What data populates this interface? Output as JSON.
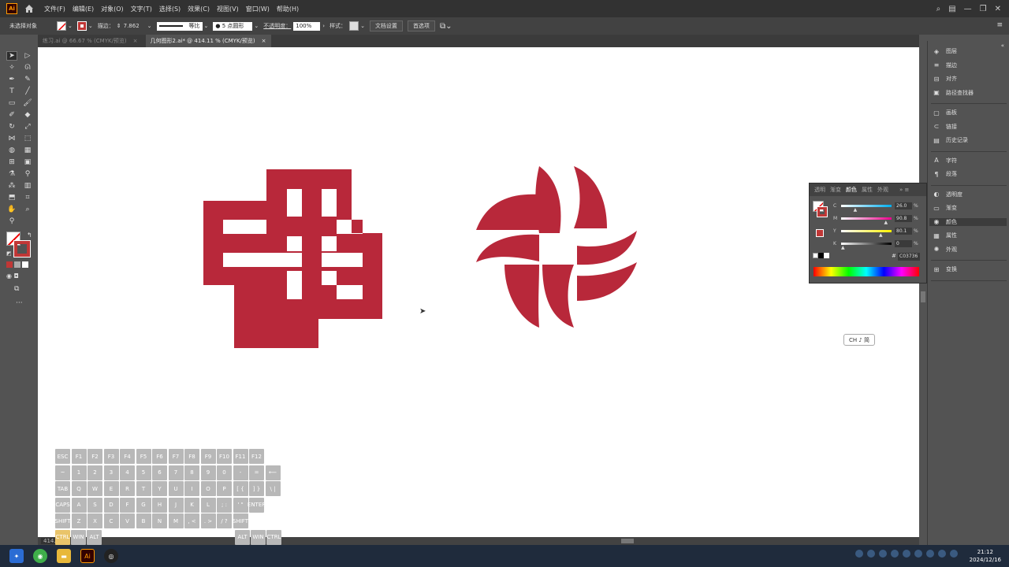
{
  "app": {
    "logo": "Ai"
  },
  "menubar": {
    "items": [
      "文件(F)",
      "编辑(E)",
      "对象(O)",
      "文字(T)",
      "选择(S)",
      "效果(C)",
      "视图(V)",
      "窗口(W)",
      "帮助(H)"
    ]
  },
  "control": {
    "selection": "未选择对象",
    "stroke_label": "描边：",
    "stroke_value": "7.862",
    "line_style": "等比",
    "brush": "5 点圆形",
    "opacity_label": "不透明度：",
    "opacity_value": "100%",
    "style_label": "样式：",
    "doc_setup": "文档设置",
    "prefs": "首选项"
  },
  "tabs": [
    {
      "label": "练习.ai @ 66.67 % (CMYK/预览)",
      "active": false
    },
    {
      "label": "几何图形2.ai* @ 414.11 % (CMYK/预览)",
      "active": true
    }
  ],
  "tab_close": "×",
  "panels": {
    "group1": [
      "图层",
      "描边",
      "对齐",
      "路径查找器"
    ],
    "group2": [
      "画板",
      "链接",
      "历史记录"
    ],
    "group3": [
      "字符",
      "段落"
    ],
    "group4": [
      "透明度",
      "渐变",
      "颜色",
      "属性",
      "外观"
    ],
    "group5": [
      "变换"
    ],
    "active": "颜色"
  },
  "color_panel": {
    "tabs": [
      "透明",
      "渐变",
      "颜色",
      "属性",
      "外观"
    ],
    "active_tab": "颜色",
    "channels": [
      {
        "label": "C",
        "value": "26.0",
        "unit": "%",
        "level": 0.26
      },
      {
        "label": "M",
        "value": "90.8",
        "unit": "%",
        "level": 0.908
      },
      {
        "label": "Y",
        "value": "80.1",
        "unit": "%",
        "level": 0.801
      },
      {
        "label": "K",
        "value": "0",
        "unit": "%",
        "level": 0
      }
    ],
    "hex": "C03736"
  },
  "ime_badge": "CH ♪ 简",
  "zoom": "414.1",
  "keyboard": {
    "row1": [
      "ESC",
      "F1",
      "F2",
      "F3",
      "F4",
      "F5",
      "F6",
      "F7",
      "F8",
      "F9",
      "F10",
      "F11",
      "F12"
    ],
    "row2": [
      "~",
      "1",
      "2",
      "3",
      "4",
      "5",
      "6",
      "7",
      "8",
      "9",
      "0",
      "-",
      "=",
      "⟵"
    ],
    "row3": [
      "TAB",
      "Q",
      "W",
      "E",
      "R",
      "T",
      "Y",
      "U",
      "I",
      "O",
      "P",
      "[ {",
      "] }",
      "\\ |"
    ],
    "row4": [
      "CAPS",
      "A",
      "S",
      "D",
      "F",
      "G",
      "H",
      "J",
      "K",
      "L",
      ";  :",
      "'  \"",
      "ENTER"
    ],
    "row5": [
      "SHIFT",
      "Z",
      "X",
      "C",
      "V",
      "B",
      "N",
      "M",
      ", <",
      ". >",
      "/ ?",
      "SHIFT"
    ],
    "row6": [
      "CTRL",
      "WIN",
      "ALT",
      "ALT",
      "WIN",
      "CTRL"
    ]
  },
  "clock": {
    "time": "21:12",
    "date": "2024/12/16"
  },
  "colors": {
    "logo_red": "#b8283a",
    "accent": "#ff9a00"
  }
}
